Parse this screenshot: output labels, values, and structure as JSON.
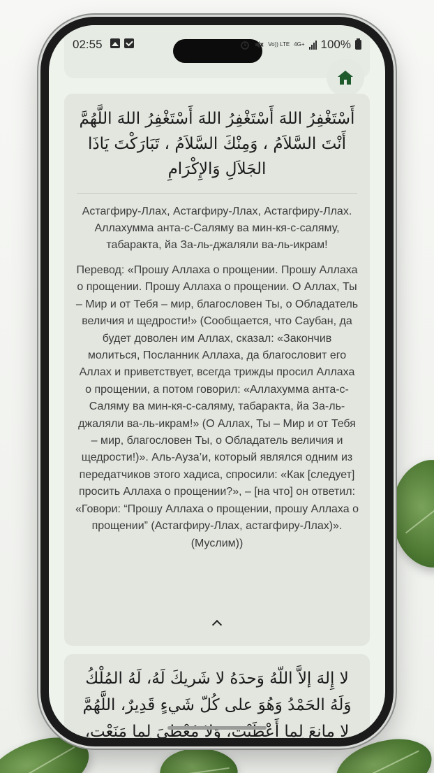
{
  "status_bar": {
    "time": "02:55",
    "network": "Vo)) LTE",
    "network_gen": "4G+",
    "battery": "100%"
  },
  "icons": {
    "home": "home-icon",
    "collapse": "chevron-up-icon",
    "gallery": "image-icon",
    "check": "check-icon",
    "alarm": "alarm-icon",
    "mute": "mute-icon",
    "signal": "signal-icon",
    "battery": "battery-icon"
  },
  "colors": {
    "accent": "#1f5a2c",
    "card_bg": "#e2e6df",
    "screen_bg": "#eef4ec"
  },
  "dua_1": {
    "arabic": "أَسْتَغْفِرُ اللهَ أَسْتَغْفِرُ اللهَ أَسْتَغْفِرُ اللهَ اللَّهُمَّ أَنْتَ السَّلاَمُ ، وَمِنْكَ السَّلاَمُ ، تَبَارَكْتَ يَاذَا الجَلاَلِ وَالإِكْرَامِ",
    "transliteration": "Астагфиру-Ллах, Астагфиру-Ллах, Астагфиру-Ллах. Аллахумма анта-с-Саляму ва мин-кя-с-саляму, табаракта, йа За-ль-джаляли ва-ль-икрам!",
    "translation": "Перевод: «Прошу Аллаха о прощении. Прошу Аллаха о прощении. Прошу Аллаха о прощении. О Аллах, Ты – Мир и от Тебя – мир, благословен Ты, о Обладатель величия и щедрости!» (Сообщается, что Саубан, да будет доволен им Аллах, сказал: «Закончив молиться, Посланник Аллаха, да благословит его Аллах и приветствует, всегда трижды просил Аллаха о прощении, а потом говорил: «Аллахумма анта-с-Саляму ва мин-кя-с-саляму, табаракта, йа За-ль-джаляли ва-ль-икрам!» (О Аллах, Ты – Мир и от Тебя – мир, благословен Ты, о Обладатель величия и щедрости!)». Аль-Ауза’и, который являлся одним из передатчиков этого хадиса, спросили: «Как [следует] просить Аллаха о прощении?», – [на что] он ответил: «Говори: “Прошу Аллаха о прощении, прошу Аллаха о прощении” (Астагфиру-Ллах, астагфиру-Ллах)». (Муслим))"
  },
  "dua_2": {
    "arabic": "لا إِلهَ إلاَّ اللّهُ وَحدَهُ لا شَريكَ لَهُ، لَهُ المُلْكُ وَلَهُ الحَمْدُ وَهُوَ على كُلّ شَيءٍ قَدِيرٌ، اللَّهُمَّ لا مانِعَ لِما أَعْطَيْت، وَلا مُعْطِيَ لِما مَنَعْت، وَلا يَنْفَعُ ذا الجَدِّ مِنْكَ الجَد"
  }
}
